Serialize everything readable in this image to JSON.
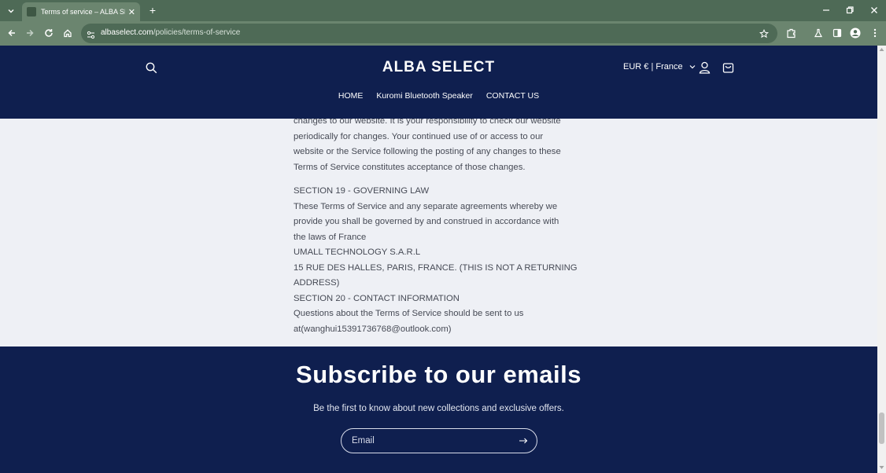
{
  "browser": {
    "tab_title": "Terms of service – ALBA SELECT",
    "url_host": "albaselect.com",
    "url_path": "/policies/terms-of-service"
  },
  "header": {
    "brand": "ALBA SELECT",
    "currency": "EUR € | France",
    "nav": [
      "HOME",
      "Kuromi Bluetooth Speaker",
      "CONTACT US"
    ]
  },
  "content": {
    "para1": [
      "changes to our website. It is your responsibility to check our website",
      "periodically for changes. Your continued use of or access to our",
      "website or the Service following the posting of any changes to these",
      "Terms of Service constitutes acceptance of those changes."
    ],
    "para2": [
      "SECTION 19 - GOVERNING LAW",
      "These Terms of Service and any separate agreements whereby we",
      "provide you shall be governed by and construed in accordance with",
      "the laws of France",
      "UMALL TECHNOLOGY S.A.R.L",
      "15 RUE DES HALLES, PARIS, FRANCE. (THIS IS NOT A RETURNING",
      "ADDRESS)",
      "SECTION 20 - CONTACT INFORMATION",
      "Questions about the Terms of Service should be sent to us",
      "at(wanghui15391736768@outlook.com)"
    ]
  },
  "footer": {
    "title": "Subscribe to our emails",
    "subtitle": "Be the first to know about new collections and exclusive offers.",
    "email_placeholder": "Email"
  },
  "colors": {
    "header_bg": "#0f1f4f",
    "page_bg": "#eef0f5",
    "chrome_dark": "#4e6a56",
    "chrome_light": "#6b856f"
  }
}
